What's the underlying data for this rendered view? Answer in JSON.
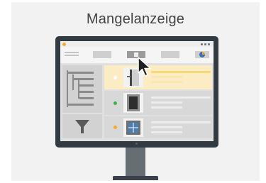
{
  "title": "Mangelanzeige",
  "colors": {
    "monitor_frame": "#333b42",
    "selected_row": "#fcecc4",
    "accent_orange": "#f7a928",
    "status_green": "#3cb043",
    "status_orange": "#f7a928",
    "status_yellow": "#f5d78e"
  },
  "toolbar": {
    "menu_icon": "hamburger-icon",
    "buttons": [
      {
        "icon": "blank"
      },
      {
        "icon": "edit-icon",
        "active": true
      },
      {
        "icon": "blank"
      },
      {
        "icon": "pie-chart-icon"
      }
    ]
  },
  "sidebar": {
    "tree_icon": "tree-view-icon",
    "filter_icon": "funnel-icon"
  },
  "rows": [
    {
      "status": "yellow",
      "selected": true,
      "thumbnail": "door-thumbnail-icon"
    },
    {
      "status": "green",
      "selected": false,
      "thumbnail": "cabinet-thumbnail-icon"
    },
    {
      "status": "orange",
      "selected": false,
      "thumbnail": "window-thumbnail-icon"
    }
  ],
  "cursor_icon": "mouse-pointer-icon"
}
